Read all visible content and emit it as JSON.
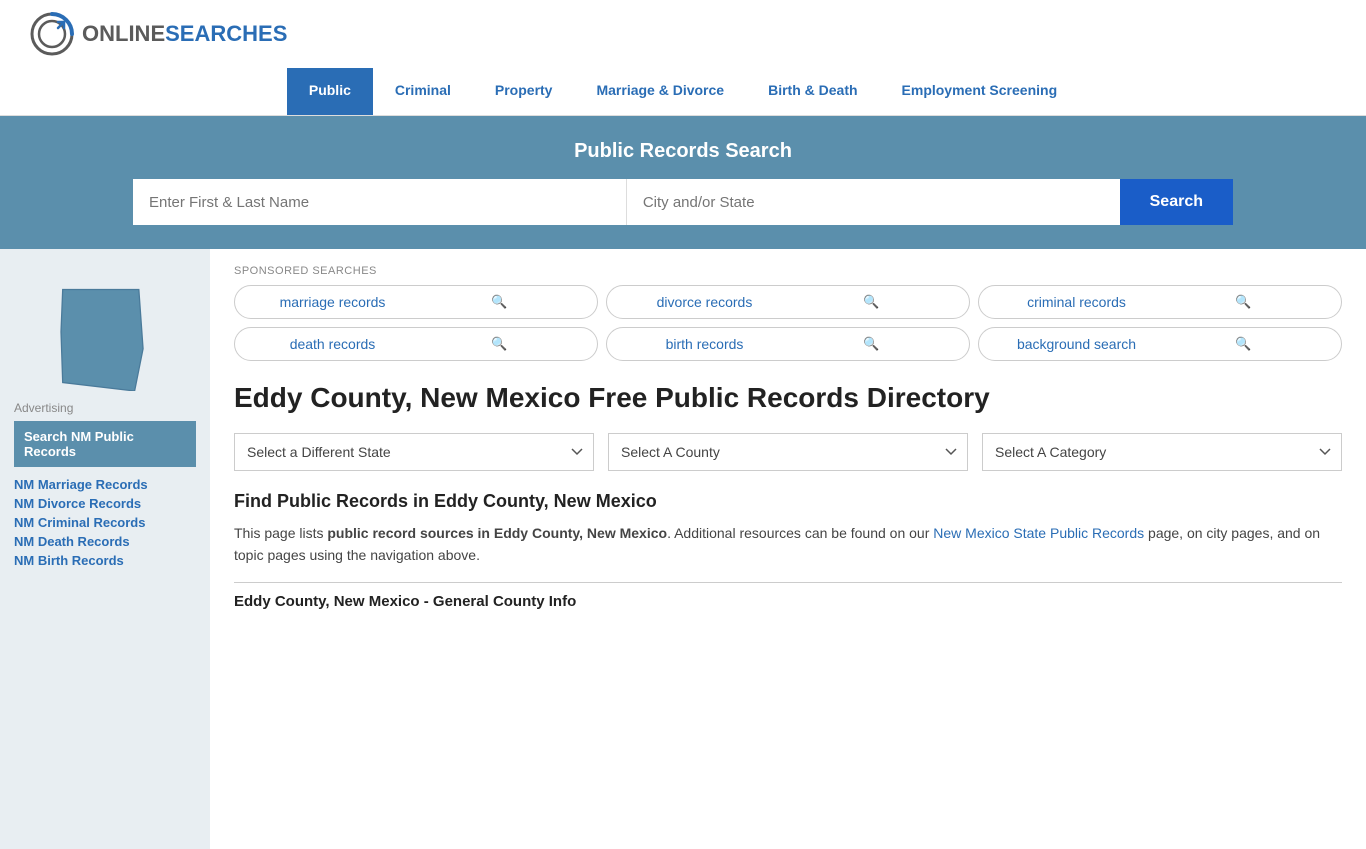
{
  "header": {
    "logo_online": "ONLINE",
    "logo_searches": "SEARCHES"
  },
  "nav": {
    "items": [
      {
        "label": "Public",
        "active": true
      },
      {
        "label": "Criminal",
        "active": false
      },
      {
        "label": "Property",
        "active": false
      },
      {
        "label": "Marriage & Divorce",
        "active": false
      },
      {
        "label": "Birth & Death",
        "active": false
      },
      {
        "label": "Employment Screening",
        "active": false
      }
    ]
  },
  "search_banner": {
    "title": "Public Records Search",
    "name_placeholder": "Enter First & Last Name",
    "location_placeholder": "City and/or State",
    "button_label": "Search"
  },
  "sponsored": {
    "label": "SPONSORED SEARCHES",
    "pills": [
      {
        "label": "marriage records"
      },
      {
        "label": "divorce records"
      },
      {
        "label": "criminal records"
      },
      {
        "label": "death records"
      },
      {
        "label": "birth records"
      },
      {
        "label": "background search"
      }
    ]
  },
  "page": {
    "title": "Eddy County, New Mexico Free Public Records Directory",
    "dropdowns": {
      "state": "Select a Different State",
      "county": "Select A County",
      "category": "Select A Category"
    },
    "find_heading": "Find Public Records in Eddy County, New Mexico",
    "find_text_intro": "This page lists ",
    "find_text_bold": "public record sources in Eddy County, New Mexico",
    "find_text_mid": ". Additional resources can be found on our ",
    "find_link_label": "New Mexico State Public Records",
    "find_text_end": " page, on city pages, and on topic pages using the navigation above.",
    "general_info_heading": "Eddy County, New Mexico - General County Info"
  },
  "sidebar": {
    "ad_label": "Advertising",
    "ad_box_text": "Search NM Public Records",
    "links": [
      {
        "label": "NM Marriage Records"
      },
      {
        "label": "NM Divorce Records"
      },
      {
        "label": "NM Criminal Records"
      },
      {
        "label": "NM Death Records"
      },
      {
        "label": "NM Birth Records"
      }
    ]
  }
}
